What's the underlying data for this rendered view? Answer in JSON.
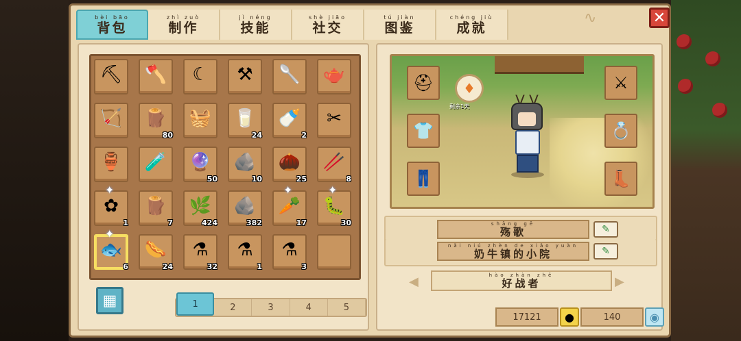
{
  "tabs": [
    {
      "pinyin": "bèi bāo",
      "label": "背包"
    },
    {
      "pinyin": "zhì zuò",
      "label": "制作"
    },
    {
      "pinyin": "jì néng",
      "label": "技能"
    },
    {
      "pinyin": "shè jiāo",
      "label": "社交"
    },
    {
      "pinyin": "tú jiàn",
      "label": "图鉴"
    },
    {
      "pinyin": "chéng jiù",
      "label": "成就"
    }
  ],
  "close_label": "✕",
  "inventory": {
    "slots": [
      {
        "icon": "pickaxe-icon",
        "glyph": "⛏",
        "count": ""
      },
      {
        "icon": "axe-icon",
        "glyph": "🪓",
        "count": ""
      },
      {
        "icon": "scythe-icon",
        "glyph": "☾",
        "count": ""
      },
      {
        "icon": "hoe-icon",
        "glyph": "⚒",
        "count": ""
      },
      {
        "icon": "shovel-icon",
        "glyph": "🥄",
        "count": ""
      },
      {
        "icon": "watering-can-icon",
        "glyph": "🫖",
        "count": ""
      },
      {
        "icon": "bow-icon",
        "glyph": "🏹",
        "count": ""
      },
      {
        "icon": "wood-plank-icon",
        "glyph": "🪵",
        "count": "80"
      },
      {
        "icon": "basket-icon",
        "glyph": "🧺",
        "count": ""
      },
      {
        "icon": "milk-jug-icon",
        "glyph": "🥛",
        "count": "24"
      },
      {
        "icon": "milk-bottle-icon",
        "glyph": "🍼",
        "count": "2"
      },
      {
        "icon": "shears-icon",
        "glyph": "✂",
        "count": ""
      },
      {
        "icon": "water-jar-icon",
        "glyph": "🏺",
        "count": ""
      },
      {
        "icon": "green-potion-icon",
        "glyph": "🧪",
        "count": ""
      },
      {
        "icon": "purple-orb-icon",
        "glyph": "🔮",
        "count": "50"
      },
      {
        "icon": "ore-rock-icon",
        "glyph": "🪨",
        "count": "10"
      },
      {
        "icon": "seed-icon",
        "glyph": "🌰",
        "count": "25"
      },
      {
        "icon": "stick-icon",
        "glyph": "🥢",
        "count": "8"
      },
      {
        "icon": "blue-flower-icon",
        "glyph": "✿",
        "count": "1",
        "star": true
      },
      {
        "icon": "hardwood-icon",
        "glyph": "🪵",
        "count": "7"
      },
      {
        "icon": "branch-icon",
        "glyph": "🌿",
        "count": "424"
      },
      {
        "icon": "stone-icon",
        "glyph": "🪨",
        "count": "382"
      },
      {
        "icon": "root-icon",
        "glyph": "🥕",
        "count": "17",
        "star": true
      },
      {
        "icon": "worm-icon",
        "glyph": "🐛",
        "count": "30",
        "star": true
      },
      {
        "icon": "fish-icon",
        "glyph": "🐟",
        "count": "6",
        "star": true,
        "selected": true
      },
      {
        "icon": "sausage-icon",
        "glyph": "🌭",
        "count": "24"
      },
      {
        "icon": "red-potion-icon",
        "glyph": "⚗",
        "count": "32"
      },
      {
        "icon": "red-potion-small-icon",
        "glyph": "⚗",
        "count": "1"
      },
      {
        "icon": "blue-potion-icon",
        "glyph": "⚗",
        "count": "3"
      },
      {
        "icon": "empty-slot",
        "glyph": "",
        "count": ""
      }
    ],
    "pages": [
      "1",
      "2",
      "3",
      "4",
      "5"
    ],
    "active_page": "1"
  },
  "character": {
    "buff_label": "剩余1天",
    "name": {
      "pinyin": "shāng gē",
      "label": "殇歌"
    },
    "farm": {
      "pinyin": "nǎi niú zhèn de xiǎo yuàn",
      "label": "奶牛镇的小院"
    },
    "title": {
      "pinyin": "hào zhàn zhě",
      "label": "好战者"
    },
    "gold": "17121",
    "gems": "140"
  }
}
